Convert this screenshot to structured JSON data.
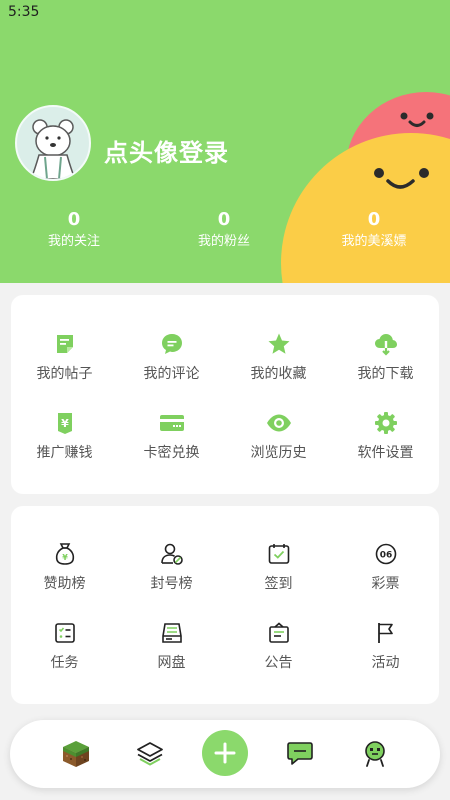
{
  "status_bar": {
    "time": "5:35"
  },
  "profile": {
    "login_prompt": "点头像登录",
    "stats": [
      {
        "value": "0",
        "label": "我的关注"
      },
      {
        "value": "0",
        "label": "我的粉丝"
      },
      {
        "value": "0",
        "label": "我的美溪嫖"
      }
    ]
  },
  "menu1": [
    {
      "label": "我的帖子",
      "icon": "post-icon"
    },
    {
      "label": "我的评论",
      "icon": "comment-icon"
    },
    {
      "label": "我的收藏",
      "icon": "star-icon"
    },
    {
      "label": "我的下载",
      "icon": "cloud-download-icon"
    },
    {
      "label": "推广赚钱",
      "icon": "yen-icon"
    },
    {
      "label": "卡密兑换",
      "icon": "card-icon"
    },
    {
      "label": "浏览历史",
      "icon": "eye-icon"
    },
    {
      "label": "软件设置",
      "icon": "gear-icon"
    }
  ],
  "menu2": [
    {
      "label": "赞助榜",
      "icon": "money-bag-icon"
    },
    {
      "label": "封号榜",
      "icon": "user-ban-icon"
    },
    {
      "label": "签到",
      "icon": "calendar-check-icon",
      "badge": ""
    },
    {
      "label": "彩票",
      "icon": "lottery-ball-icon",
      "badge": "06"
    },
    {
      "label": "任务",
      "icon": "task-list-icon"
    },
    {
      "label": "网盘",
      "icon": "drive-icon"
    },
    {
      "label": "公告",
      "icon": "notice-icon"
    },
    {
      "label": "活动",
      "icon": "flag-icon"
    }
  ],
  "bottom_nav": [
    {
      "name": "home",
      "icon": "grass-block-icon"
    },
    {
      "name": "layers",
      "icon": "layers-icon"
    },
    {
      "name": "add",
      "icon": "plus-icon"
    },
    {
      "name": "messages",
      "icon": "chat-icon"
    },
    {
      "name": "me",
      "icon": "creeper-icon"
    }
  ],
  "colors": {
    "primary": "#8bd96c",
    "pink_blob": "#f5737a",
    "yellow_blob": "#fbcd47",
    "card_bg": "#ffffff",
    "page_bg": "#f2f2f2"
  }
}
